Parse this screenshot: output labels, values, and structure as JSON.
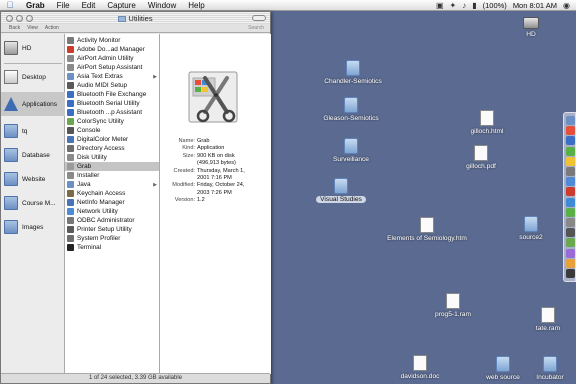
{
  "menubar": {
    "app_name": "Grab",
    "menus": [
      "File",
      "Edit",
      "Capture",
      "Window",
      "Help"
    ],
    "battery": "(100%)",
    "clock": "Mon 8:01 AM"
  },
  "window": {
    "title": "Utilities",
    "toolbar": [
      "Back",
      "View",
      "Action"
    ],
    "search_label": "Search",
    "status": "1 of 24 selected, 3.39 GB available"
  },
  "sidebar": {
    "items": [
      "HD",
      "Desktop",
      "Applications",
      "tq",
      "Database",
      "Website",
      "Course M...",
      "Images"
    ],
    "selected_index": 2
  },
  "utilities": {
    "items": [
      "Activity Monitor",
      "Adobe Do...ad Manager",
      "AirPort Admin Utility",
      "AirPort Setup Assistant",
      "Asia Text Extras",
      "Audio MIDI Setup",
      "Bluetooth File Exchange",
      "Bluetooth Serial Utility",
      "Bluetooth ...p Assistant",
      "ColorSync Utility",
      "Console",
      "DigitalColor Meter",
      "Directory Access",
      "Disk Utility",
      "Grab",
      "Installer",
      "Java",
      "Keychain Access",
      "NetInfo Manager",
      "Network Utility",
      "ODBC Administrator",
      "Printer Setup Utility",
      "System Profiler",
      "Terminal"
    ],
    "selected": "Grab",
    "folders": [
      "Asia Text Extras",
      "Java"
    ]
  },
  "preview": {
    "fields": [
      {
        "k": "Name:",
        "v": "Grab"
      },
      {
        "k": "Kind:",
        "v": "Application"
      },
      {
        "k": "Size:",
        "v": "900 KB on disk"
      },
      {
        "k": "",
        "v": "(496,913 bytes)"
      },
      {
        "k": "Created:",
        "v": "Thursday, March 1,"
      },
      {
        "k": "",
        "v": "2001 7:16 PM"
      },
      {
        "k": "Modified:",
        "v": "Friday, October 24,"
      },
      {
        "k": "",
        "v": "2003 7:26 PM"
      },
      {
        "k": "Version:",
        "v": "1.2"
      }
    ]
  },
  "desktop": {
    "icons": [
      {
        "label": "HD",
        "kind": "hd"
      },
      {
        "label": "Chandler-Semiotics",
        "kind": "folder"
      },
      {
        "label": "Gleason-Semiotics",
        "kind": "folder"
      },
      {
        "label": "gilloch.html",
        "kind": "doc"
      },
      {
        "label": "gilloch.pdf",
        "kind": "doc"
      },
      {
        "label": "Surveillance",
        "kind": "folder"
      },
      {
        "label": "Visual Studies",
        "kind": "folder",
        "selected": true
      },
      {
        "label": "Elements of Semiology.htm",
        "kind": "doc"
      },
      {
        "label": "source2",
        "kind": "folder"
      },
      {
        "label": "prog5-1.ram",
        "kind": "doc"
      },
      {
        "label": "tate.ram",
        "kind": "doc"
      },
      {
        "label": "davidson.doc",
        "kind": "doc"
      },
      {
        "label": "web source",
        "kind": "folder"
      },
      {
        "label": "Incubator",
        "kind": "folder"
      }
    ]
  },
  "colors": {
    "desktop": "#5a6a91",
    "selection": "#c4c4c4",
    "folder_blue": "#7fa5d4"
  }
}
